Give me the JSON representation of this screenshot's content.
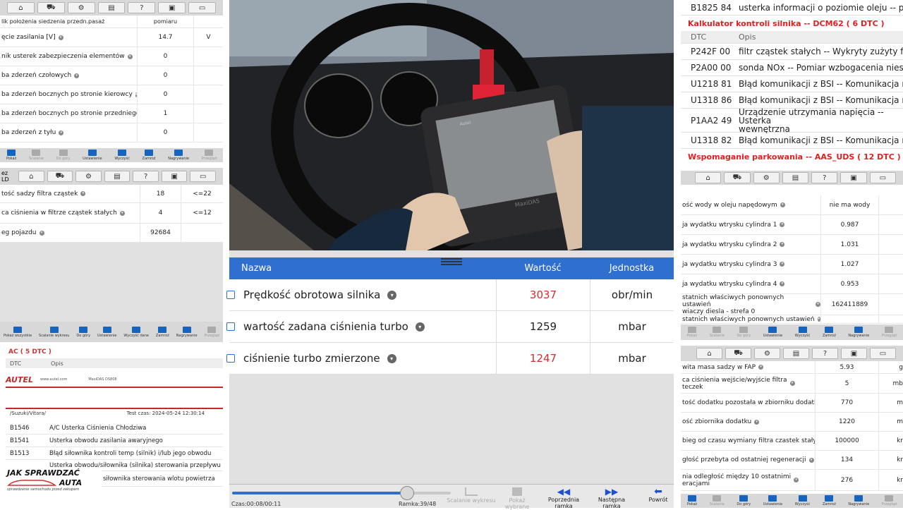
{
  "left_top": {
    "toolbar_icons": [
      "home-icon",
      "car-icon",
      "gear-icon",
      "printer-icon",
      "help-icon",
      "save-icon",
      "chat-icon"
    ],
    "header_cell": "pomiaru",
    "rows": [
      {
        "name": "lik położenia siedzenia przedn.pasaż",
        "value": "",
        "unit": ""
      },
      {
        "name": "ęcie zasilania [V]",
        "value": "14.7",
        "unit": "V"
      },
      {
        "name": "nik usterek zabezpieczenia elementów",
        "value": "0",
        "unit": ""
      },
      {
        "name": "ba zderzeń czołowych",
        "value": "0",
        "unit": ""
      },
      {
        "name": "ba zderzeń bocznych po stronie kierowcy",
        "value": "0",
        "unit": ""
      },
      {
        "name": "ba zderzeń bocznych po stronie przedniego...",
        "value": "1",
        "unit": ""
      },
      {
        "name": "ba zderzeń z tyłu",
        "value": "0",
        "unit": ""
      }
    ],
    "bottom": [
      "Pokaż",
      "Scalanie",
      "Do góry",
      "Ustawienie",
      "Wyczyść",
      "Zamroź",
      "Nagrywanie",
      "Przegląd"
    ]
  },
  "left_mid": {
    "label": "ez LD",
    "toolbar_icons": [
      "home-icon",
      "car-icon",
      "gear-icon",
      "printer-icon",
      "help-icon",
      "save-icon",
      "chat-icon"
    ],
    "rows": [
      {
        "name": "tość sadzy filtra cząstek",
        "value": "18",
        "unit": "<=22"
      },
      {
        "name": "ca ciśnienia w filtrze cząstek stałych",
        "value": "4",
        "unit": "<=12"
      },
      {
        "name": "eg pojazdu",
        "value": "92684",
        "unit": ""
      }
    ],
    "bottom": [
      "Pokaż wszystkie",
      "Scalanie wykresu",
      "Do góry",
      "Ustawienie",
      "Wyczyść dane",
      "Zamroź",
      "Nagrywanie",
      "Przegląd"
    ]
  },
  "left_bottom": {
    "section": "AC ( 5 DTC )",
    "col_dtc": "DTC",
    "col_opis": "Opis",
    "brand": "AUTEL",
    "site": "www.autel.com",
    "model": "MaxiDAS DS808",
    "vehicle": "/Suzuki/Vitara/",
    "test_time": "Test czas:  2024-05-24 12:30:14",
    "codes": [
      {
        "code": "B1546",
        "desc": "A/C Usterka Ciśnienia Chłodziwa"
      },
      {
        "code": "B1541",
        "desc": "Usterka obwodu zasilania awaryjnego"
      },
      {
        "code": "B1513",
        "desc": "Błąd siłownika kontroli temp (silnik) i/lub jego obwodu"
      },
      {
        "code": "",
        "desc": "Usterka obwodu/siłownika (silnika) sterowania przepływu"
      },
      {
        "code": "",
        "desc": "siłownika sterowania wlotu powietrza"
      }
    ],
    "logo_line1": "JAK SPRAWDZAĆ",
    "logo_line2": "AUTA",
    "logo_tag": "sprawdzanie samochodu przed zakupem"
  },
  "center": {
    "photo_brand": "Autel",
    "photo_model": "MaxiDAS",
    "col_name": "Nazwa",
    "col_value": "Wartość",
    "col_unit": "Jednostka",
    "rows": [
      {
        "name": "Prędkość obrotowa silnika",
        "value": "3037",
        "unit": "obr/min",
        "red": true
      },
      {
        "name": "wartość zadana ciśnienia turbo",
        "value": "1259",
        "unit": "mbar",
        "red": false
      },
      {
        "name": "ciśnienie turbo zmierzone",
        "value": "1247",
        "unit": "mbar",
        "red": true
      }
    ],
    "time": "Czas:00:08/00:11",
    "frame": "Ramka:39/48",
    "progress": 0.8,
    "buttons": [
      {
        "label": "Scalanie wykresu",
        "icon": "chart-icon",
        "enabled": false
      },
      {
        "label": "Pokaż wybrane",
        "icon": "check-icon",
        "enabled": false
      },
      {
        "label": "Poprzednia ramka",
        "icon": "prev-frame-icon",
        "enabled": true
      },
      {
        "label": "Następna ramka",
        "icon": "next-frame-icon",
        "enabled": true
      },
      {
        "label": "Powrót",
        "icon": "back-icon",
        "enabled": true
      }
    ]
  },
  "right_top": {
    "pre_row": {
      "code": "B1825 84",
      "desc": "usterka informacji o poziomie oleju -- pozi"
    },
    "section1": "Kalkulator kontroli silnika -- DCM62 ( 6 DTC )",
    "col_dtc": "DTC",
    "col_opis": "Opis",
    "codes": [
      {
        "code": "P242F 00",
        "desc": "filtr cząstek stałych -- Wykryty zużyty filtr"
      },
      {
        "code": "P2A00 00",
        "desc": "sonda NOx -- Pomiar wzbogacenia niesprawny"
      },
      {
        "code": "U1218 81",
        "desc": "Błąd komunikacji z BSI -- Komunikacja nieprawi"
      },
      {
        "code": "U1318 86",
        "desc": "Błąd komunikacji z BSI -- Komunikacja nieprawi"
      },
      {
        "code": "P1AA2 49",
        "desc": "Urządzenie utrzymania napięcia -- Usterka\nwewnętrzna"
      },
      {
        "code": "U1318 82",
        "desc": "Błąd komunikacji z BSI -- Komunikacja nieprawi"
      }
    ],
    "section2": "Wspomaganie parkowania -- AAS_UDS ( 12 DTC )"
  },
  "right_mid": {
    "toolbar_icons": [
      "home-icon",
      "car-icon",
      "gear-icon",
      "printer-icon",
      "help-icon",
      "save-icon",
      "chat-icon"
    ],
    "rows": [
      {
        "name": "ość wody w oleju napędowym",
        "value": "nie ma wody"
      },
      {
        "name": "ja wydatku wtrysku cylindra 1",
        "value": "0.987"
      },
      {
        "name": "ja wydatku wtrysku cylindra 2",
        "value": "1.031"
      },
      {
        "name": "ja wydatku wtrysku cylindra 3",
        "value": "1.027"
      },
      {
        "name": "ja wydatku wtrysku cylindra 4",
        "value": "0.953"
      },
      {
        "name": "statnich właściwych ponownych ustawień\nwiaczy diesla - strefa 0",
        "value": "162411889"
      },
      {
        "name": "statnich właściwych ponownych ustawień",
        "value": ""
      }
    ],
    "bottom": [
      "Pokaż",
      "Scalanie",
      "Do góry",
      "Ustawienie",
      "Wyczyść",
      "Zamroź",
      "Nagrywanie",
      "Przegląd"
    ]
  },
  "right_bottom": {
    "toolbar_icons": [
      "home-icon",
      "car-icon",
      "gear-icon",
      "printer-icon",
      "help-icon",
      "save-icon",
      "chat-icon"
    ],
    "rows": [
      {
        "name": "wita masa sadzy w FAP",
        "value": "5.93",
        "unit": "g"
      },
      {
        "name": "ca ciśnienia wejście/wyjście filtra\nteczek",
        "value": "5",
        "unit": "mb"
      },
      {
        "name": "tość dodatku pozostała w zbiorniku dodatku",
        "value": "770",
        "unit": "m"
      },
      {
        "name": "ość zbiornika dodatku",
        "value": "1220",
        "unit": "m"
      },
      {
        "name": "bieg od czasu wymiany filtra czastek stałych",
        "value": "100000",
        "unit": "kr"
      },
      {
        "name": "głość przebyta od ostatniej regeneracji",
        "value": "134",
        "unit": "kr"
      },
      {
        "name": "nia odległość między 10 ostatnimi\neracjami",
        "value": "276",
        "unit": "kr"
      }
    ],
    "bottom": [
      "Pokaż",
      "Scalanie",
      "Do góry",
      "Ustawienie",
      "Wyczyść",
      "Zamroź",
      "Nagrywanie",
      "Przegląd"
    ]
  }
}
